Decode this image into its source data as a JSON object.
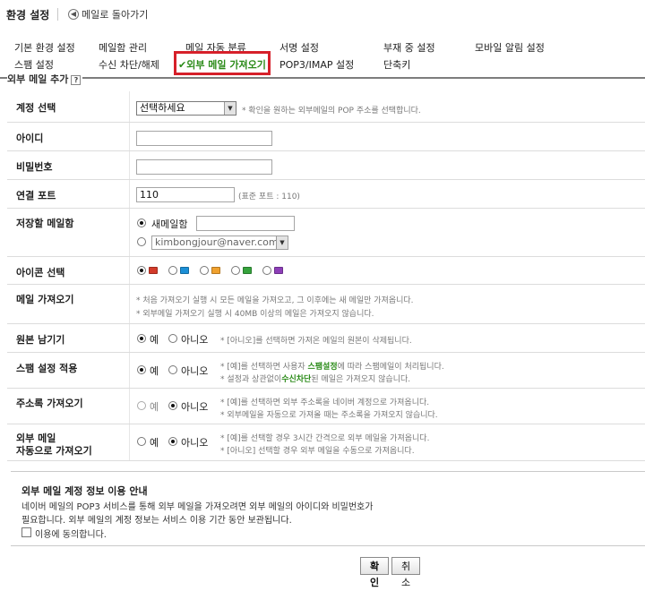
{
  "header": {
    "title": "환경 설정",
    "back_label": "메일로 돌아가기"
  },
  "menu": {
    "items": [
      {
        "label": "기본 환경 설정"
      },
      {
        "label": "메일함 관리"
      },
      {
        "label": "메일 자동 분류"
      },
      {
        "label": "서명 설정"
      },
      {
        "label": "부재 중 설정"
      },
      {
        "label": "모바일 알림 설정"
      },
      {
        "label": "스팸 설정"
      },
      {
        "label": "수신 차단/해제"
      },
      {
        "label": "외부 메일 가져오기",
        "active": true
      },
      {
        "label": "POP3/IMAP 설정"
      },
      {
        "label": "단축키"
      }
    ],
    "active_check": "✔"
  },
  "section": {
    "title": "외부 메일 추가",
    "help": "?"
  },
  "form": {
    "account": {
      "label": "계정 선택",
      "selected": "선택하세요",
      "hint": "* 확인을 원하는 외부메일의 POP 주소를 선택합니다."
    },
    "id": {
      "label": "아이디",
      "value": ""
    },
    "password": {
      "label": "비밀번호",
      "value": ""
    },
    "port": {
      "label": "연결 포트",
      "value": "110",
      "hint": "(표준 포트 : 110)"
    },
    "mailbox": {
      "label": "저장할 메일함",
      "option_new": "새메일함",
      "new_value": "",
      "selected_existing": "kimbongjour@naver.com"
    },
    "icon": {
      "label": "아이콘 선택",
      "colors": [
        "#d33b2a",
        "#1b8fd6",
        "#f0a12e",
        "#36a33d",
        "#8d3fb8"
      ]
    },
    "fetch": {
      "label": "메일 가져오기",
      "hint1": "* 처음 가져오기 실행 시 모든 메일을 가져오고, 그 이후에는 새 메일만 가져옵니다.",
      "hint2": "* 외부메일 가져오기 실행 시 40MB 이상의 메일은 가져오지 않습니다."
    },
    "keep": {
      "label": "원본 남기기",
      "yes": "예",
      "no": "아니오",
      "hint": "* [아니오]를 선택하면 가져온 메일의 원본이 삭제됩니다."
    },
    "spam": {
      "label": "스팸 설정 적용",
      "yes": "예",
      "no": "아니오",
      "hint1_pre": "* [예]를 선택하면 사용자 ",
      "hint1_link": "스팸설정",
      "hint1_post": "에 따라 스팸메일이 처리됩니다.",
      "hint2_pre": "* 설정과 상관없이",
      "hint2_link": "수신차단",
      "hint2_post": "된 메일은 가져오지 않습니다."
    },
    "contacts": {
      "label": "주소록 가져오기",
      "yes": "예",
      "no": "아니오",
      "hint1": "* [예]를 선택하면 외부 주소록을 네이버 계정으로 가져옵니다.",
      "hint2": "* 외부메일을 자동으로 가져올 때는 주소록을 가져오지 않습니다."
    },
    "auto": {
      "label1": "외부 메일",
      "label2": "자동으로 가져오기",
      "yes": "예",
      "no": "아니오",
      "hint1": "* [예]를 선택할 경우 3시간 간격으로 외부 메일을 가져옵니다.",
      "hint2": "* [아니오] 선택할 경우 외부 메일을 수동으로 가져옵니다."
    }
  },
  "notice": {
    "title": "외부 메일 계정 정보 이용 안내",
    "line1": "네이버 메일의 POP3 서비스를 통해 외부 메일을 가져오려면 외부 메일의 아이디와 비밀번호가",
    "line2": "필요합니다. 외부 메일의 계정 정보는 서비스 이용 기간 동안 보관됩니다.",
    "agree": "이용에 동의합니다."
  },
  "buttons": {
    "ok": "확인",
    "cancel": "취소"
  }
}
